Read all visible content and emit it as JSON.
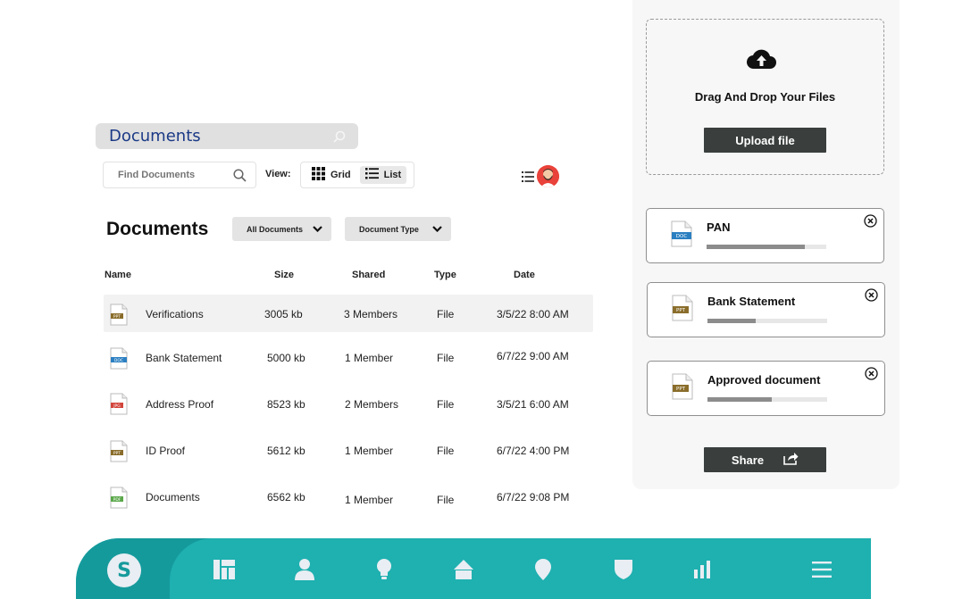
{
  "header": {
    "banner_title": "Documents",
    "search_placeholder": "Find Documents",
    "view_label": "View:",
    "view_options": [
      {
        "label": "Grid",
        "active": false
      },
      {
        "label": "List",
        "active": true
      }
    ]
  },
  "main": {
    "heading": "Documents",
    "filters": {
      "documents": "All Documents",
      "type": "Document Type"
    },
    "columns": [
      "Name",
      "Size",
      "Shared",
      "Type",
      "Date"
    ],
    "rows": [
      {
        "icon": "ppt-file-icon",
        "tag": "PPT",
        "name": "Verifications",
        "size": "3005 kb",
        "shared": "3 Members",
        "type": "File",
        "date": "3/5/22 8:00 AM",
        "selected": true
      },
      {
        "icon": "doc-file-icon",
        "tag": "DOC",
        "name": "Bank Statement",
        "size": "5000 kb",
        "shared": "1 Member",
        "type": "File",
        "date": "6/7/22 9:00 AM",
        "selected": false
      },
      {
        "icon": "jpg-file-icon",
        "tag": "JPG",
        "name": "Address Proof",
        "size": "8523 kb",
        "shared": "2 Members",
        "type": "File",
        "date": "3/5/21 6:00 AM",
        "selected": false
      },
      {
        "icon": "ppt-file-icon",
        "tag": "PPT",
        "name": "ID Proof",
        "size": "5612 kb",
        "shared": "1 Member",
        "type": "File",
        "date": "6/7/22 4:00 PM",
        "selected": false
      },
      {
        "icon": "pdf-file-icon",
        "tag": "PDF",
        "name": "Documents",
        "size": "6562 kb",
        "shared": "1 Member",
        "type": "File",
        "date": "6/7/22 9:08 PM",
        "selected": false
      }
    ]
  },
  "upload": {
    "drop_title": "Drag And Drop Your Files",
    "upload_button": "Upload file",
    "files": [
      {
        "name": "PAN",
        "tag": "DOC",
        "progress": 0.82
      },
      {
        "name": "Bank Statement",
        "tag": "PPT",
        "progress": 0.4
      },
      {
        "name": "Approved document",
        "tag": "PPT",
        "progress": 0.54
      }
    ],
    "share_button": "Share"
  },
  "bottom_nav": {
    "logo": "S",
    "items": [
      "dashboard-icon",
      "user-icon",
      "bulb-icon",
      "home-icon",
      "location-icon",
      "shield-icon",
      "bar-chart-icon",
      "menu-icon"
    ]
  },
  "colors": {
    "accent": "#1fb0b0",
    "accent_dark": "#159a9c",
    "banner_text": "#1b3a86",
    "button_dark": "#3a3f3e",
    "doc_tag": "#2b7fc1",
    "ppt_tag": "#8a6d2b",
    "jpg_tag": "#d2453c",
    "pdf_tag": "#5aa84a"
  }
}
